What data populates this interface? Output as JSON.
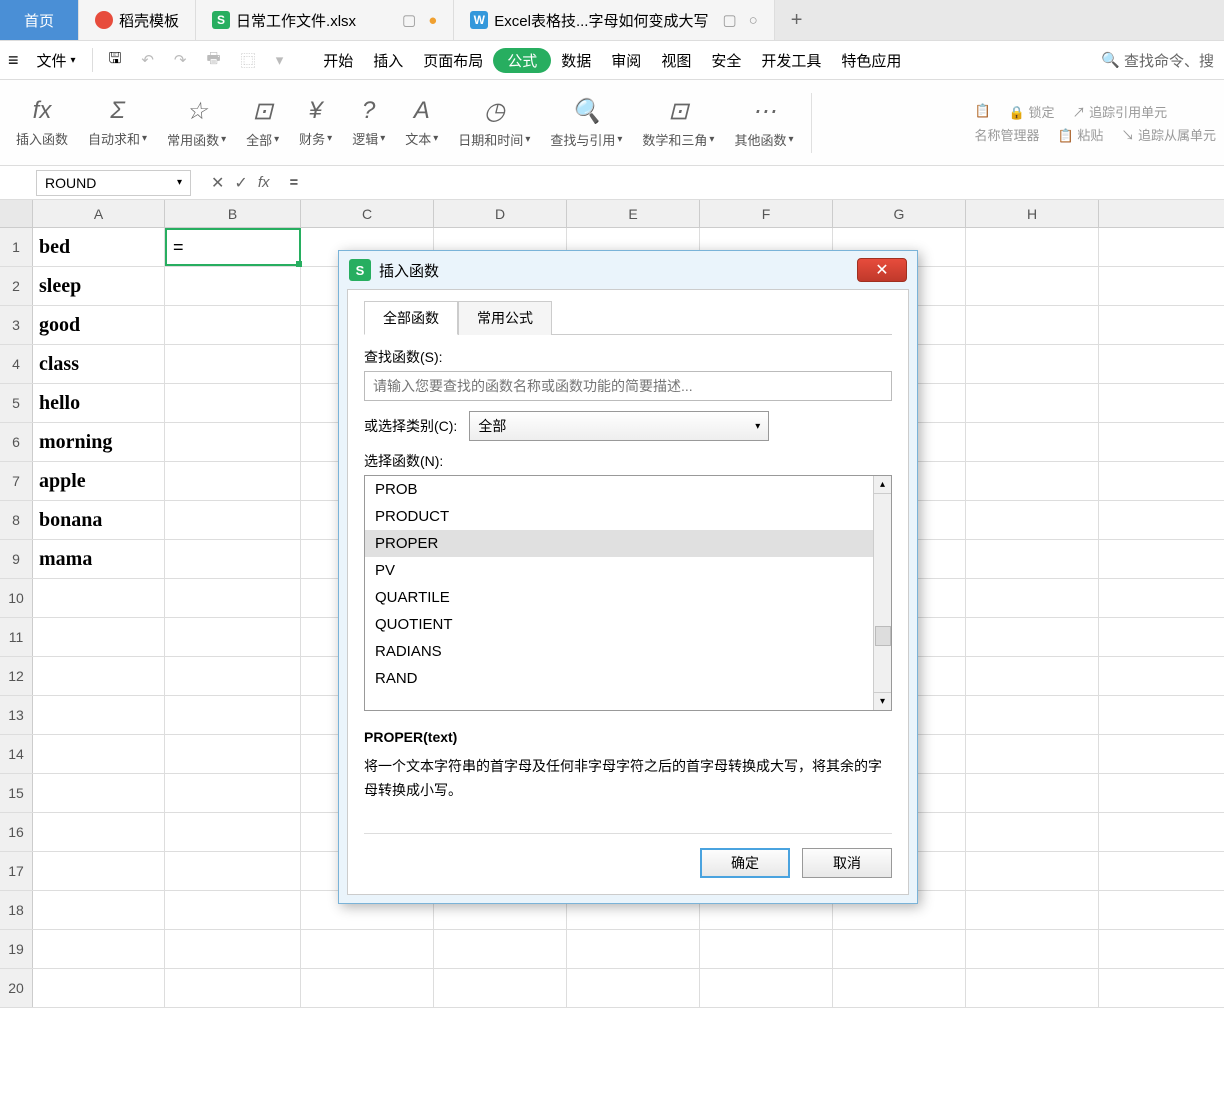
{
  "tabs": {
    "home": "首页",
    "t1": "稻壳模板",
    "t2": "日常工作文件.xlsx",
    "t3": "Excel表格技...字母如何变成大写"
  },
  "menu": {
    "file": "文件",
    "start": "开始",
    "insert": "插入",
    "layout": "页面布局",
    "formula": "公式",
    "data": "数据",
    "review": "审阅",
    "view": "视图",
    "security": "安全",
    "dev": "开发工具",
    "special": "特色应用",
    "search": "查找命令、搜"
  },
  "ribbon": {
    "insertfn": "插入函数",
    "autosum": "自动求和",
    "common": "常用函数",
    "all": "全部",
    "finance": "财务",
    "logic": "逻辑",
    "text": "文本",
    "datetime": "日期和时间",
    "lookup": "查找与引用",
    "mathtrig": "数学和三角",
    "other": "其他函数",
    "namemgr": "名称管理器",
    "paste": "粘贴",
    "lock": "锁定",
    "traceprec": "追踪引用单元",
    "tracedep": "追踪从属单元"
  },
  "namebox": "ROUND",
  "formula_value": "=",
  "columns": [
    "A",
    "B",
    "C",
    "D",
    "E",
    "F",
    "G",
    "H"
  ],
  "cells": {
    "A1": "bed",
    "B1": "=",
    "A2": "sleep",
    "A3": "good",
    "A4": "class",
    "A5": "hello",
    "A6": "morning",
    "A7": "apple",
    "A8": "bonana",
    "A9": "mama"
  },
  "dialog": {
    "title": "插入函数",
    "tab1": "全部函数",
    "tab2": "常用公式",
    "search_label": "查找函数(S):",
    "search_placeholder": "请输入您要查找的函数名称或函数功能的简要描述...",
    "category_label": "或选择类别(C):",
    "category_value": "全部",
    "select_label": "选择函数(N):",
    "functions": [
      "PROB",
      "PRODUCT",
      "PROPER",
      "PV",
      "QUARTILE",
      "QUOTIENT",
      "RADIANS",
      "RAND"
    ],
    "selected_fn": "PROPER",
    "desc_title": "PROPER(text)",
    "desc_text": "将一个文本字符串的首字母及任何非字母字符之后的首字母转换成大写，将其余的字母转换成小写。",
    "ok": "确定",
    "cancel": "取消"
  }
}
